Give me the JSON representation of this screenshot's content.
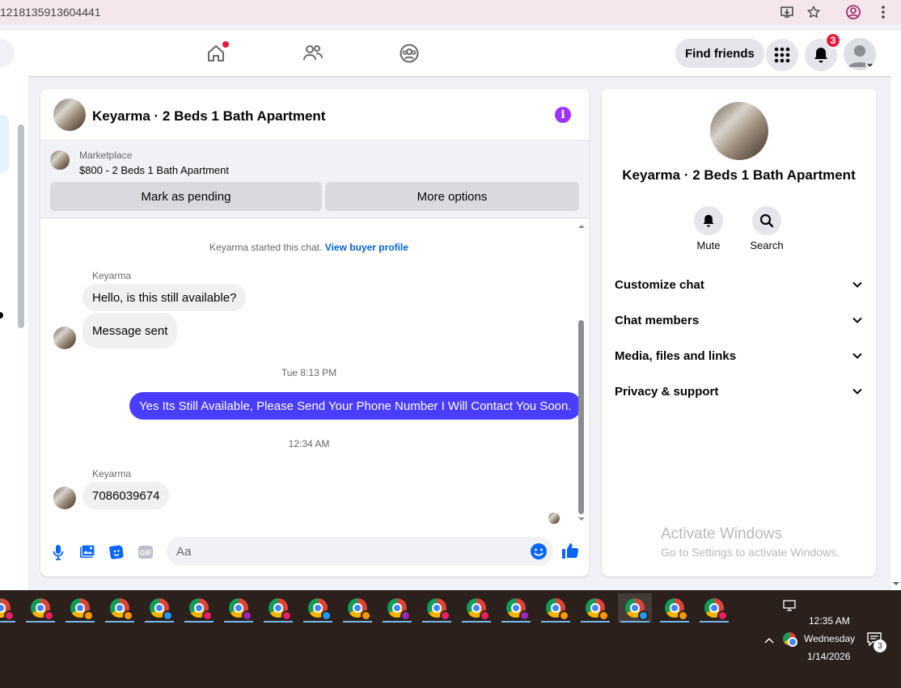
{
  "browser": {
    "url_fragment": "1218135913604441"
  },
  "nav": {
    "find_friends": "Find friends",
    "notification_count": "3"
  },
  "chat": {
    "title": "Keyarma · 2 Beds 1 Bath Apartment",
    "marketplace_label": "Marketplace",
    "listing": "$800 - 2 Beds 1 Bath Apartment",
    "mark_pending": "Mark as pending",
    "more_options": "More options",
    "started_text": "Keyarma started this chat.",
    "view_buyer_profile": "View buyer profile",
    "messages": [
      {
        "sender": "Keyarma",
        "text": "Hello, is this still available?"
      },
      {
        "text": "Message sent"
      },
      {
        "timestamp": "Tue 8:13 PM"
      },
      {
        "text": "Yes Its Still Available, Please Send Your Phone Number I Will Contact You Soon."
      },
      {
        "timestamp": "12:34 AM"
      },
      {
        "sender": "Keyarma",
        "text": "7086039674"
      }
    ],
    "composer_placeholder": "Aa"
  },
  "info": {
    "title": "Keyarma · 2 Beds 1 Bath Apartment",
    "actions": [
      {
        "label": "Mute",
        "icon": "bell-icon"
      },
      {
        "label": "Search",
        "icon": "search-icon"
      }
    ],
    "menu": [
      {
        "label": "Customize chat"
      },
      {
        "label": "Chat members"
      },
      {
        "label": "Media, files and links"
      },
      {
        "label": "Privacy & support"
      }
    ],
    "watermark_title": "Activate Windows",
    "watermark_sub": "Go to Settings to activate Windows."
  },
  "taskbar": {
    "time": "12:35 AM",
    "day": "Wednesday",
    "date": "1/14/2026",
    "notification_count": "3",
    "profile_colors": [
      "#e91e63",
      "#e91e63",
      "#ff9800",
      "#ff9800",
      "#2196f3",
      "#e91e63",
      "#9c27b0",
      "#e91e63",
      "#2196f3",
      "#ff9800",
      "#9c27b0",
      "#e91e63",
      "#e91e63",
      "#9c27b0",
      "#ff9800",
      "#ff9800",
      "#2196f3",
      "#ff9800",
      "#e91e63"
    ]
  },
  "colors": {
    "accent_blue": "#0064d1",
    "my_bubble": "#4a3dff",
    "info_purple": "#a033ff",
    "notif_red": "#e41e3f"
  }
}
